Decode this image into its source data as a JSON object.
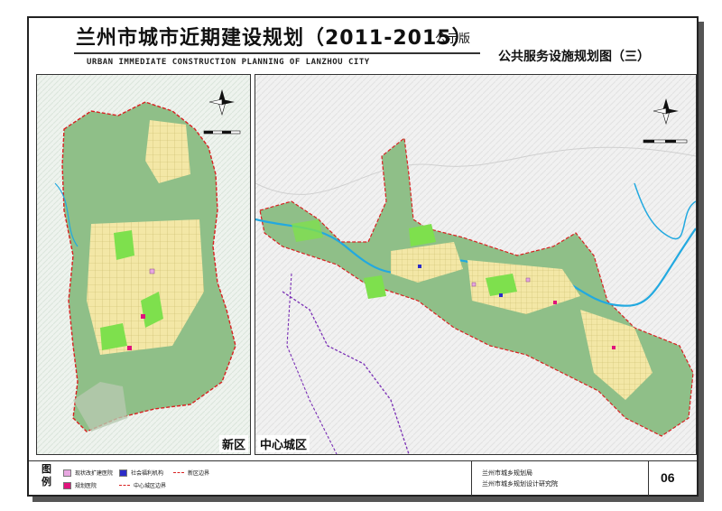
{
  "title": {
    "main": "兰州市城市近期建设规划（2011-2015）",
    "badge": "公示版",
    "english": "URBAN IMMEDIATE CONSTRUCTION PLANNING OF LANZHOU CITY",
    "subtitle": "公共服务设施规划图（三）"
  },
  "panels": {
    "left": {
      "label": "新区"
    },
    "right": {
      "label": "中心城区"
    }
  },
  "legend": {
    "title": "图例",
    "items": [
      {
        "label": "现状改扩建医院",
        "color": "#e7a7e0"
      },
      {
        "label": "规划医院",
        "color": "#e0137c"
      },
      {
        "label": "社会福利机构",
        "color": "#2c2cc8"
      },
      {
        "label": "中心城区边界",
        "color": "#d92121"
      },
      {
        "label": "新区边界",
        "color": "#d92121"
      }
    ]
  },
  "organizations": [
    "兰州市城乡规划局",
    "兰州市城乡规划设计研究院"
  ],
  "page_number": "06",
  "colors": {
    "river": "#22a9e0",
    "district_boundary": "#7a2fb5",
    "planning_boundary": "#d92121",
    "terrain": "#8fbf88",
    "built_area": "#f3e7a6",
    "green_space": "#7ee04d"
  }
}
